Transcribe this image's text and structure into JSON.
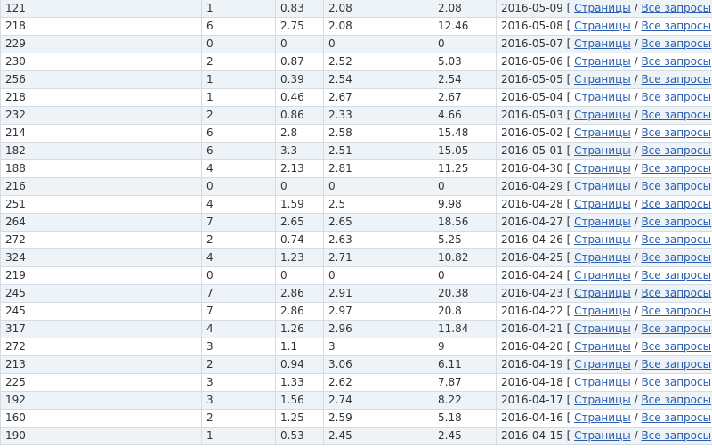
{
  "links": {
    "open_bracket": "[",
    "pages_label": "Страницы",
    "separator": "/",
    "all_queries_label": "Все запросы",
    "close_bracket": "]"
  },
  "rows": [
    {
      "c1": "121",
      "c2": "1",
      "c3": "0.83",
      "c4": "2.08",
      "c5": "2.08",
      "date": "2016-05-09"
    },
    {
      "c1": "218",
      "c2": "6",
      "c3": "2.75",
      "c4": "2.08",
      "c5": "12.46",
      "date": "2016-05-08"
    },
    {
      "c1": "229",
      "c2": "0",
      "c3": "0",
      "c4": "0",
      "c5": "0",
      "date": "2016-05-07"
    },
    {
      "c1": "230",
      "c2": "2",
      "c3": "0.87",
      "c4": "2.52",
      "c5": "5.03",
      "date": "2016-05-06"
    },
    {
      "c1": "256",
      "c2": "1",
      "c3": "0.39",
      "c4": "2.54",
      "c5": "2.54",
      "date": "2016-05-05"
    },
    {
      "c1": "218",
      "c2": "1",
      "c3": "0.46",
      "c4": "2.67",
      "c5": "2.67",
      "date": "2016-05-04"
    },
    {
      "c1": "232",
      "c2": "2",
      "c3": "0.86",
      "c4": "2.33",
      "c5": "4.66",
      "date": "2016-05-03"
    },
    {
      "c1": "214",
      "c2": "6",
      "c3": "2.8",
      "c4": "2.58",
      "c5": "15.48",
      "date": "2016-05-02"
    },
    {
      "c1": "182",
      "c2": "6",
      "c3": "3.3",
      "c4": "2.51",
      "c5": "15.05",
      "date": "2016-05-01"
    },
    {
      "c1": "188",
      "c2": "4",
      "c3": "2.13",
      "c4": "2.81",
      "c5": "11.25",
      "date": "2016-04-30"
    },
    {
      "c1": "216",
      "c2": "0",
      "c3": "0",
      "c4": "0",
      "c5": "0",
      "date": "2016-04-29"
    },
    {
      "c1": "251",
      "c2": "4",
      "c3": "1.59",
      "c4": "2.5",
      "c5": "9.98",
      "date": "2016-04-28"
    },
    {
      "c1": "264",
      "c2": "7",
      "c3": "2.65",
      "c4": "2.65",
      "c5": "18.56",
      "date": "2016-04-27"
    },
    {
      "c1": "272",
      "c2": "2",
      "c3": "0.74",
      "c4": "2.63",
      "c5": "5.25",
      "date": "2016-04-26"
    },
    {
      "c1": "324",
      "c2": "4",
      "c3": "1.23",
      "c4": "2.71",
      "c5": "10.82",
      "date": "2016-04-25"
    },
    {
      "c1": "219",
      "c2": "0",
      "c3": "0",
      "c4": "0",
      "c5": "0",
      "date": "2016-04-24"
    },
    {
      "c1": "245",
      "c2": "7",
      "c3": "2.86",
      "c4": "2.91",
      "c5": "20.38",
      "date": "2016-04-23"
    },
    {
      "c1": "245",
      "c2": "7",
      "c3": "2.86",
      "c4": "2.97",
      "c5": "20.8",
      "date": "2016-04-22"
    },
    {
      "c1": "317",
      "c2": "4",
      "c3": "1.26",
      "c4": "2.96",
      "c5": "11.84",
      "date": "2016-04-21"
    },
    {
      "c1": "272",
      "c2": "3",
      "c3": "1.1",
      "c4": "3",
      "c5": "9",
      "date": "2016-04-20"
    },
    {
      "c1": "213",
      "c2": "2",
      "c3": "0.94",
      "c4": "3.06",
      "c5": "6.11",
      "date": "2016-04-19"
    },
    {
      "c1": "225",
      "c2": "3",
      "c3": "1.33",
      "c4": "2.62",
      "c5": "7.87",
      "date": "2016-04-18"
    },
    {
      "c1": "192",
      "c2": "3",
      "c3": "1.56",
      "c4": "2.74",
      "c5": "8.22",
      "date": "2016-04-17"
    },
    {
      "c1": "160",
      "c2": "2",
      "c3": "1.25",
      "c4": "2.59",
      "c5": "5.18",
      "date": "2016-04-16"
    },
    {
      "c1": "190",
      "c2": "1",
      "c3": "0.53",
      "c4": "2.45",
      "c5": "2.45",
      "date": "2016-04-15"
    }
  ]
}
